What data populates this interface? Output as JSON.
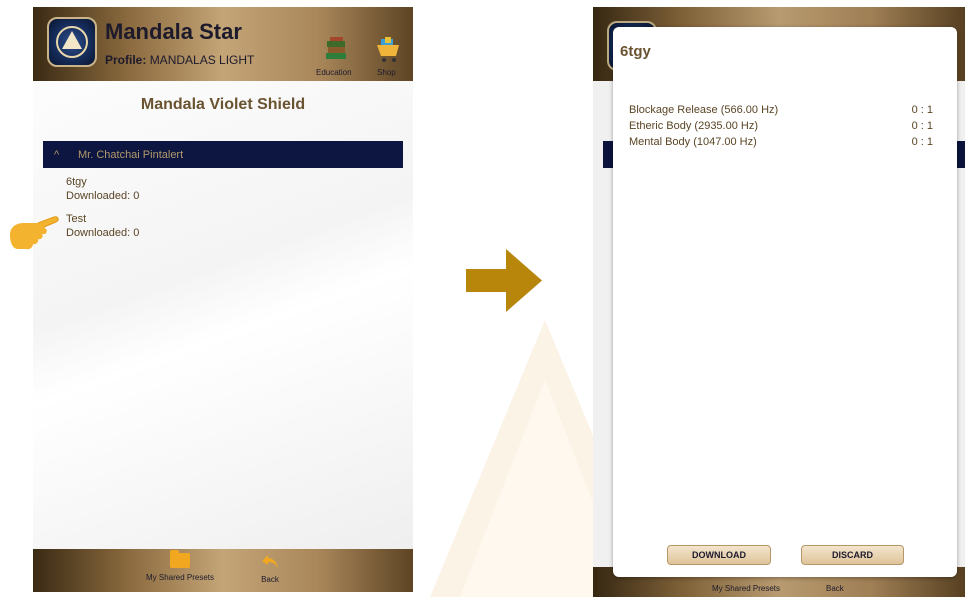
{
  "left_screen": {
    "header": {
      "app_title": "Mandala Star",
      "profile_label": "Profile:",
      "profile_name": "MANDALAS LIGHT",
      "education_label": "Education",
      "shop_label": "Shop"
    },
    "page_title": "Mandala Violet Shield",
    "group": {
      "name": "Mr. Chatchai Pintalert",
      "chevron": "^"
    },
    "presets": [
      {
        "name": "6tgy",
        "downloaded": "Downloaded: 0"
      },
      {
        "name": "Test",
        "downloaded": "Downloaded: 0"
      }
    ],
    "bottom_nav": {
      "shared_presets_label": "My Shared Presets",
      "back_label": "Back"
    }
  },
  "right_screen": {
    "dialog": {
      "title": "6tgy",
      "frequencies": [
        {
          "name": "Blockage Release (566.00 Hz)",
          "ratio": "0 : 1"
        },
        {
          "name": "Etheric Body (2935.00 Hz)",
          "ratio": "0 : 1"
        },
        {
          "name": "Mental Body (1047.00 Hz)",
          "ratio": "0 : 1"
        }
      ],
      "download_label": "DOWNLOAD",
      "discard_label": "DISCARD"
    },
    "bottom_nav": {
      "shared_presets_label": "My Shared Presets",
      "back_label": "Back"
    }
  },
  "colors": {
    "gold_dark": "#3a2a14",
    "gold_light": "#c4a577",
    "navy": "#0d1640",
    "arrow": "#b8860b",
    "text_brown": "#5a4525"
  },
  "icons": {
    "hand": "pointing-hand-icon",
    "arrow": "right-arrow-icon"
  }
}
